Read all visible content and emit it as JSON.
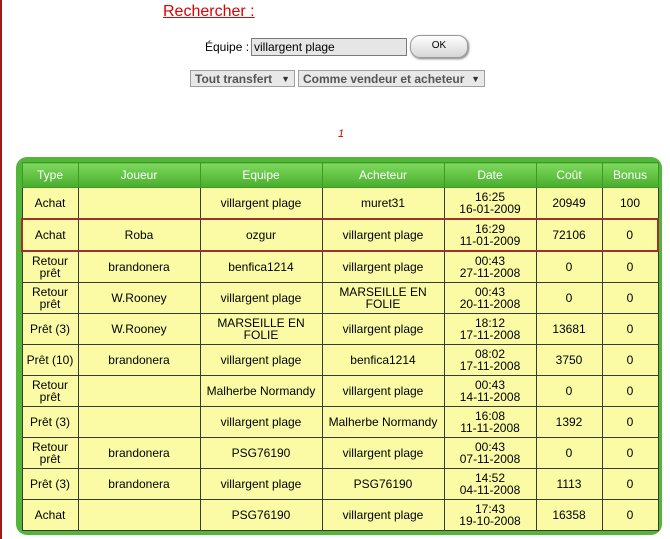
{
  "search": {
    "title": "Rechercher :",
    "team_label": "Équipe :",
    "team_value": "villargent plage",
    "ok_label": "OK",
    "transfer_filter": "Tout transfert",
    "role_filter": "Comme vendeur et acheteur"
  },
  "pagination": {
    "current_page": "1"
  },
  "table": {
    "headers": [
      "Type",
      "Joueur",
      "Equipe",
      "Acheteur",
      "Date",
      "Coût",
      "Bonus"
    ],
    "rows": [
      {
        "type": "Achat",
        "player": "",
        "team": "villargent plage",
        "buyer": "muret31",
        "time": "16:25",
        "date": "16-01-2009",
        "cost": "20949",
        "bonus": "100"
      },
      {
        "type": "Achat",
        "player": "Roba",
        "team": "ozgur",
        "buyer": "villargent plage",
        "time": "16:29",
        "date": "11-01-2009",
        "cost": "72106",
        "bonus": "0"
      },
      {
        "type": "Retour prêt",
        "player": "brandonera",
        "team": "benfica1214",
        "buyer": "villargent plage",
        "time": "00:43",
        "date": "27-11-2008",
        "cost": "0",
        "bonus": "0"
      },
      {
        "type": "Retour prêt",
        "player": "W.Rooney",
        "team": "villargent plage",
        "buyer": "MARSEILLE EN FOLIE",
        "time": "00:43",
        "date": "20-11-2008",
        "cost": "0",
        "bonus": "0"
      },
      {
        "type": "Prêt (3)",
        "player": "W.Rooney",
        "team": "MARSEILLE EN FOLIE",
        "buyer": "villargent plage",
        "time": "18:12",
        "date": "17-11-2008",
        "cost": "13681",
        "bonus": "0"
      },
      {
        "type": "Prêt (10)",
        "player": "brandonera",
        "team": "villargent plage",
        "buyer": "benfica1214",
        "time": "08:02",
        "date": "17-11-2008",
        "cost": "3750",
        "bonus": "0"
      },
      {
        "type": "Retour prêt",
        "player": "",
        "team": "Malherbe Normandy",
        "buyer": "villargent plage",
        "time": "00:43",
        "date": "14-11-2008",
        "cost": "0",
        "bonus": "0"
      },
      {
        "type": "Prêt (3)",
        "player": "",
        "team": "villargent plage",
        "buyer": "Malherbe Normandy",
        "time": "16:08",
        "date": "11-11-2008",
        "cost": "1392",
        "bonus": "0"
      },
      {
        "type": "Retour prêt",
        "player": "brandonera",
        "team": "PSG76190",
        "buyer": "villargent plage",
        "time": "00:43",
        "date": "07-11-2008",
        "cost": "0",
        "bonus": "0"
      },
      {
        "type": "Prêt (3)",
        "player": "brandonera",
        "team": "villargent plage",
        "buyer": "PSG76190",
        "time": "14:52",
        "date": "04-11-2008",
        "cost": "1113",
        "bonus": "0"
      },
      {
        "type": "Achat",
        "player": "",
        "team": "PSG76190",
        "buyer": "villargent plage",
        "time": "17:43",
        "date": "19-10-2008",
        "cost": "16358",
        "bonus": "0"
      }
    ]
  }
}
